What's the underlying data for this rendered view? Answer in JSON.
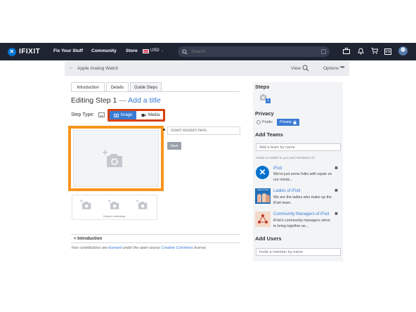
{
  "nav": {
    "logo": "IFIXIT",
    "links": [
      "Fix Your Stuff",
      "Community",
      "Store"
    ],
    "currency": "USD",
    "search_placeholder": "Search",
    "lang": "EN",
    "icons": [
      "toolbox-icon",
      "bell-icon",
      "cart-icon",
      "language-icon",
      "user-avatar"
    ]
  },
  "subheader": {
    "back_label": "Apple Analog Watch",
    "view_label": "View",
    "options_label": "Options"
  },
  "tabs": [
    "Introduction",
    "Details",
    "Guide Steps"
  ],
  "active_tab": "Guide Steps",
  "editor": {
    "heading": "Editing Step 1",
    "dash": "—",
    "add_title": "Add a title",
    "step_type_label": "Step Type:",
    "type_image": "Image",
    "type_media": "Media",
    "bullet_placeholder": "Insert wisdom here.",
    "save": "Save",
    "drag_caption": "Drag to rearrange"
  },
  "footer": {
    "intro_link": "< Introduction",
    "license_prefix": "Your contributions are ",
    "license_link1": "licensed",
    "license_mid": " under the open source ",
    "license_link2": "Creative Commons",
    "license_suffix": " license."
  },
  "sidebar": {
    "steps_heading": "Steps",
    "step_badge": "1",
    "privacy_heading": "Privacy",
    "public_label": "Public",
    "private_label": "Private",
    "add_teams_heading": "Add Teams",
    "team_search_placeholder": "Add a team by name",
    "visibility_note": "Guide is visible to you and members of:",
    "teams": [
      {
        "name": "iFixit",
        "desc": "We're just some folks with repair on our minds..."
      },
      {
        "name": "Ladies of iFixit",
        "desc": "We are the ladies who make up the iFixit team."
      },
      {
        "name": "Community Managers of iFixit",
        "desc": "iFixit's community managers strive to bring together as..."
      }
    ],
    "team_logo_text": "Ladies of iFixit",
    "add_users_heading": "Add Users",
    "user_search_placeholder": "Invite a member by name"
  },
  "colors": {
    "nav_bg": "#1f2433",
    "accent_blue": "#3a7bd5",
    "highlight_red": "#d8400c",
    "highlight_orange": "#f7941d"
  }
}
